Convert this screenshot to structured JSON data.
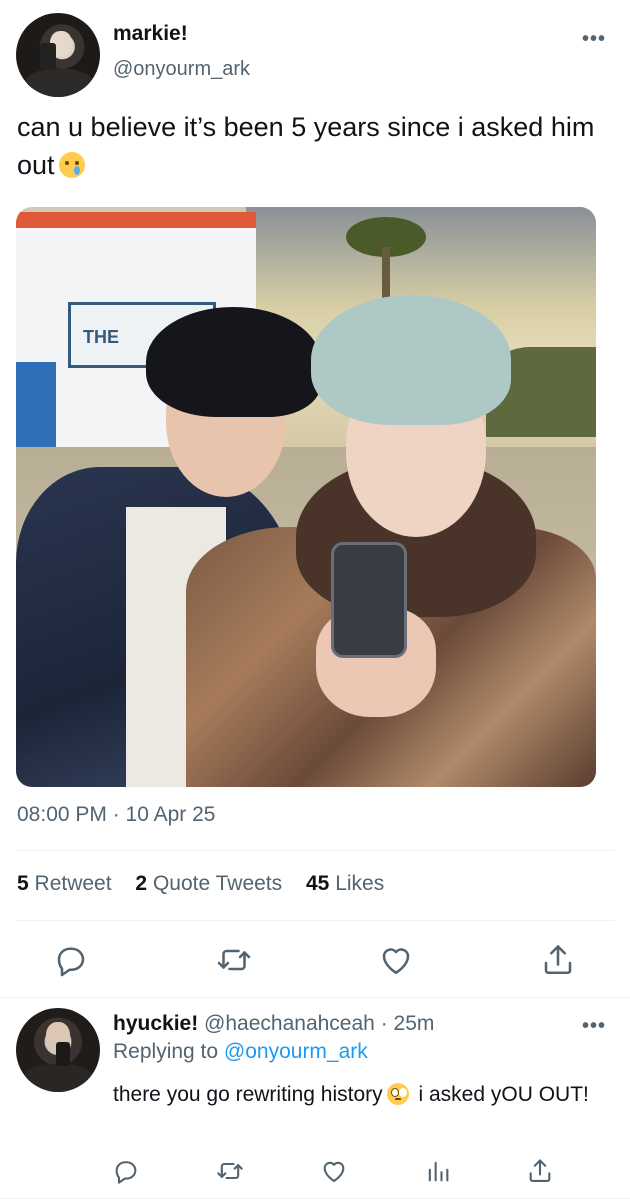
{
  "tweet": {
    "author": {
      "display_name": "markie!",
      "handle": "@onyourm_ark",
      "avatar_icon": "user-avatar"
    },
    "more_icon": "•••",
    "text": "can u believe it’s been 5 years since i asked him out",
    "text_emoji": "crying-face-emoji",
    "photo_icon": "photo-two-people-selfie",
    "timestamp": "08:00 PM · 10 Apr 25",
    "stats": {
      "retweets_count": "5",
      "retweets_label": "Retweet",
      "quotes_count": "2",
      "quotes_label": "Quote Tweets",
      "likes_count": "45",
      "likes_label": "Likes"
    },
    "actions": [
      "reply-icon",
      "retweet-icon",
      "like-icon",
      "share-icon"
    ]
  },
  "reply": {
    "author": {
      "display_name": "hyuckie!",
      "handle": "@haechanahceah",
      "time": "· 25m",
      "avatar_icon": "user-avatar"
    },
    "more_icon": "•••",
    "replying_to_label": "Replying to",
    "replying_to_handle": "@onyourm_ark",
    "text_part1": "there you go rewriting history",
    "text_emoji": "rolling-eyes-emoji",
    "text_part2": "i asked yOU OUT!",
    "actions": [
      "reply-icon",
      "retweet-icon",
      "like-icon",
      "analytics-icon",
      "share-icon"
    ]
  },
  "colors": {
    "text_primary": "#0f1419",
    "text_secondary": "#536471",
    "link": "#1d9bf0",
    "divider": "#eff3f4"
  }
}
